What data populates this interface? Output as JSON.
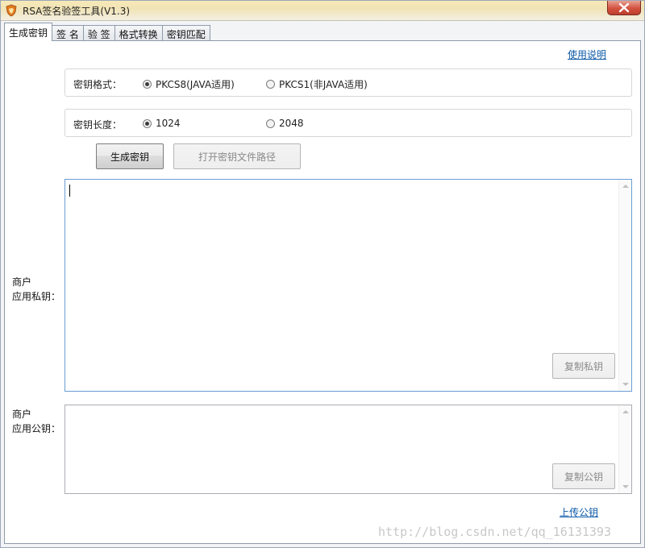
{
  "window": {
    "title": "RSA签名验签工具(V1.3)"
  },
  "tabs": [
    {
      "label": "生成密钥",
      "active": true
    },
    {
      "label": "签 名",
      "active": false
    },
    {
      "label": "验 签",
      "active": false
    },
    {
      "label": "格式转换",
      "active": false
    },
    {
      "label": "密钥匹配",
      "active": false
    }
  ],
  "help_link": "使用说明",
  "key_format": {
    "label": "密钥格式：",
    "options": [
      {
        "label": "PKCS8(JAVA适用)",
        "checked": true
      },
      {
        "label": "PKCS1(非JAVA适用)",
        "checked": false
      }
    ]
  },
  "key_length": {
    "label": "密钥长度：",
    "options": [
      {
        "label": "1024",
        "checked": true
      },
      {
        "label": "2048",
        "checked": false
      }
    ]
  },
  "buttons": {
    "generate": "生成密钥",
    "open_path": "打开密钥文件路径"
  },
  "private_key": {
    "label_line1": "商户",
    "label_line2": "应用私钥：",
    "value": "",
    "copy_button": "复制私钥"
  },
  "public_key": {
    "label_line1": "商户",
    "label_line2": "应用公钥：",
    "value": "",
    "copy_button": "复制公钥"
  },
  "upload_link": "上传公钥",
  "watermark": "http://blog.csdn.net/qq_16131393",
  "colors": {
    "titlebar": "#f0e3b5",
    "close_button": "#d3523e",
    "link": "#0b59a7",
    "focused_border": "#6b9dd5"
  },
  "icons": {
    "app": "shield-icon",
    "close": "close-icon"
  }
}
